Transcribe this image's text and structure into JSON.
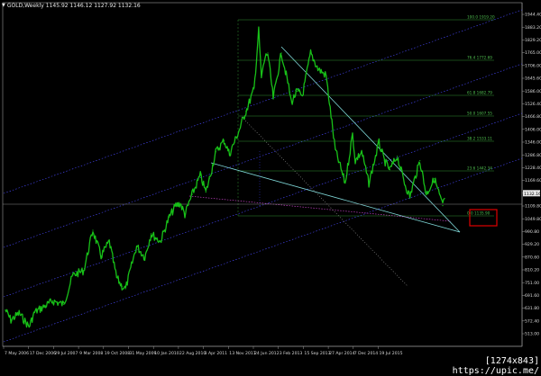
{
  "header": {
    "symbol": "GOLD,Weekly",
    "ohlc": "1145.92 1146.12 1127.92 1132.16"
  },
  "price_axis": {
    "labels": [
      "1944.40",
      "1883.20",
      "1829.20",
      "1765.00",
      "1706.00",
      "1645.60",
      "1586.00",
      "1526.40",
      "1466.80",
      "1406.00",
      "1346.00",
      "1286.80",
      "1228.40",
      "1169.60",
      "1132.16",
      "1109.80",
      "1049.80",
      "990.80",
      "929.20",
      "870.60",
      "810.20",
      "751.00",
      "691.60",
      "631.80",
      "572.40",
      "513.00"
    ],
    "current_price": "1132.16",
    "colors": {
      "current_price_bg": "#e8e8e8",
      "current_price_text": "#000000"
    }
  },
  "time_axis": {
    "labels": [
      "7 May 2006",
      "17 Dec 2006",
      "29 Jul 2007",
      "9 Mar 2008",
      "19 Oct 2008",
      "31 May 2009",
      "10 Jan 2010",
      "22 Aug 2010",
      "3 Apr 2011",
      "13 Nov 2011",
      "24 Jun 2012",
      "3 Feb 2013",
      "15 Sep 2013",
      "27 Apr 2014",
      "7 Dec 2014",
      "19 Jul 2015"
    ]
  },
  "fib_levels": {
    "labels": [
      "100.0 1919.20",
      "76.4 1772.69",
      "61.8 1682.79",
      "50.0 1607.55",
      "38.2 1533.11",
      "23.6 1442.34",
      "0.0 1135.90"
    ],
    "highlight_label": "0.0 1135.90",
    "colors": {
      "line": "#2f8f2f",
      "text": "#4fbf4f",
      "highlight_box": "#e00000"
    }
  },
  "colors": {
    "background": "#000000",
    "candles": "#18c018",
    "channel": "#4848ff",
    "fan": "#7fd8d8",
    "guide": "#9a9a9a",
    "axis_text": "#d8d8d8",
    "magenta": "#c040c0"
  },
  "watermark": "[1274x843] https://upic.me/",
  "chart_data": {
    "type": "line",
    "title": "GOLD,Weekly",
    "xlabel": "",
    "ylabel": "",
    "ylim": [
      513.0,
      1944.4
    ],
    "x_ticks": [
      "7 May 2006",
      "17 Dec 2006",
      "29 Jul 2007",
      "9 Mar 2008",
      "19 Oct 2008",
      "31 May 2009",
      "10 Jan 2010",
      "22 Aug 2010",
      "3 Apr 2011",
      "13 Nov 2011",
      "24 Jun 2012",
      "3 Feb 2013",
      "15 Sep 2013",
      "27 Apr 2014",
      "7 Dec 2014",
      "19 Jul 2015"
    ],
    "series": [
      {
        "x": [
          "2006-05-07",
          "2006-06-18",
          "2006-08-20",
          "2006-11-05",
          "2006-12-17",
          "2007-03-01",
          "2007-05-06",
          "2007-07-29",
          "2007-10-07",
          "2007-12-30",
          "2008-03-09",
          "2008-05-11",
          "2008-07-13",
          "2008-09-07",
          "2008-10-19",
          "2008-11-16",
          "2009-02-08",
          "2009-04-12",
          "2009-05-31",
          "2009-08-09",
          "2009-10-18",
          "2009-12-06",
          "2010-01-10",
          "2010-02-14",
          "2010-04-11",
          "2010-06-13",
          "2010-07-25",
          "2010-08-22",
          "2010-10-10",
          "2010-12-12",
          "2011-01-23",
          "2011-04-03",
          "2011-05-29",
          "2011-07-31",
          "2011-09-04",
          "2011-09-25",
          "2011-10-23",
          "2011-11-13",
          "2011-12-25",
          "2012-02-26",
          "2012-04-15",
          "2012-05-13",
          "2012-06-24",
          "2012-08-05",
          "2012-10-07",
          "2012-12-02",
          "2013-02-03",
          "2013-04-14",
          "2013-06-30",
          "2013-08-25",
          "2013-09-15",
          "2013-11-03",
          "2013-12-29",
          "2014-03-16",
          "2014-04-27",
          "2014-06-08",
          "2014-08-03",
          "2014-10-05",
          "2014-11-09",
          "2014-12-07",
          "2015-01-25",
          "2015-03-15",
          "2015-05-17",
          "2015-07-19",
          "2015-08-02"
        ],
        "y": [
          635,
          590,
          620,
          560,
          625,
          650,
          675,
          660,
          790,
          810,
          990,
          875,
          940,
          780,
          740,
          730,
          920,
          870,
          975,
          940,
          1050,
          1100,
          1110,
          1060,
          1150,
          1235,
          1160,
          1220,
          1340,
          1390,
          1330,
          1430,
          1520,
          1620,
          1880,
          1670,
          1760,
          1780,
          1580,
          1780,
          1650,
          1560,
          1610,
          1590,
          1780,
          1710,
          1680,
          1350,
          1200,
          1420,
          1300,
          1340,
          1200,
          1380,
          1300,
          1260,
          1320,
          1190,
          1140,
          1200,
          1300,
          1150,
          1220,
          1100,
          1132
        ]
      }
    ]
  }
}
